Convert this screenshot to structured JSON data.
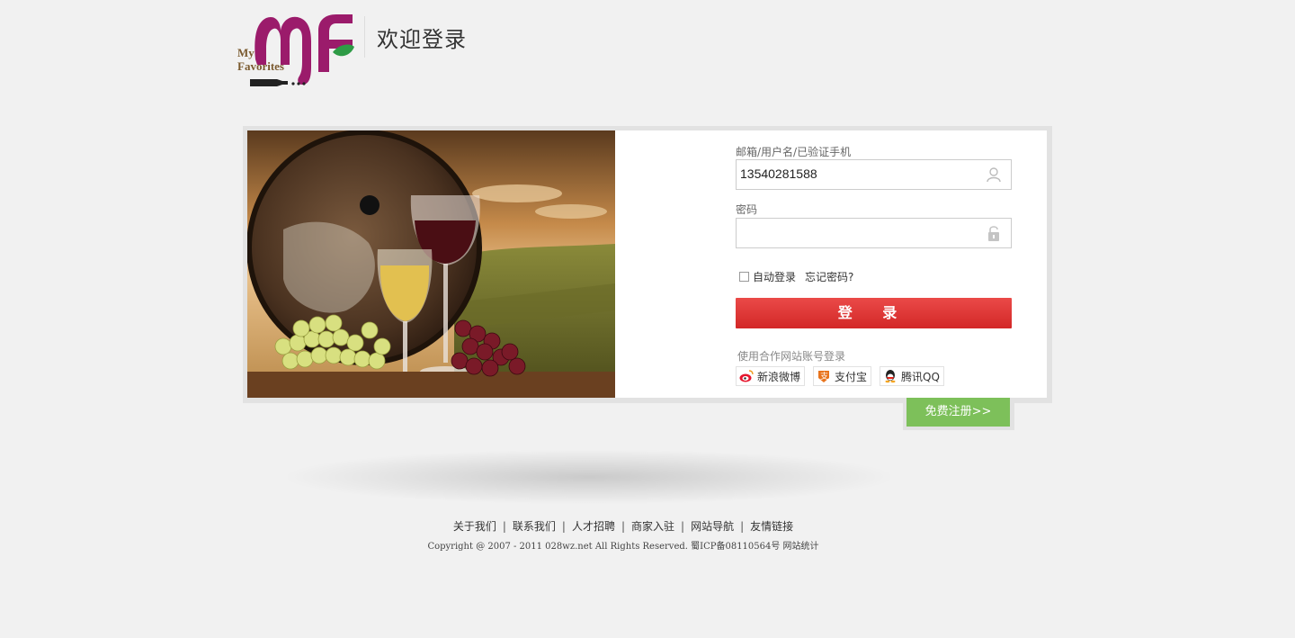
{
  "header": {
    "logo_text_line1": "My",
    "logo_text_line2": "Favorites",
    "title": "欢迎登录"
  },
  "login_form": {
    "username_label": "邮箱/用户名/已验证手机",
    "username_value": "13540281588",
    "password_label": "密码",
    "password_value": "",
    "remember_label": "自动登录",
    "forgot_label": "忘记密码?",
    "submit_label": "登 录",
    "partner_title": "使用合作网站账号登录",
    "partners": [
      {
        "label": "新浪微博",
        "icon": "weibo-icon"
      },
      {
        "label": "支付宝",
        "icon": "alipay-icon"
      },
      {
        "label": "腾讯QQ",
        "icon": "qq-icon"
      }
    ]
  },
  "register_label": "免费注册>>",
  "footer": {
    "links": [
      "关于我们",
      "联系我们",
      "人才招聘",
      "商家入驻",
      "网站导航",
      "友情链接"
    ],
    "copyright": "Copyright @ 2007 - 2011 028wz.net All Rights Reserved. 蜀ICP备08110564号 网站统计"
  },
  "colors": {
    "login_button": "#e03535",
    "register_button": "#7dc05a",
    "logo_purple": "#9b1b6b",
    "logo_green": "#2e9b46",
    "logo_brown": "#7a5a2f"
  }
}
